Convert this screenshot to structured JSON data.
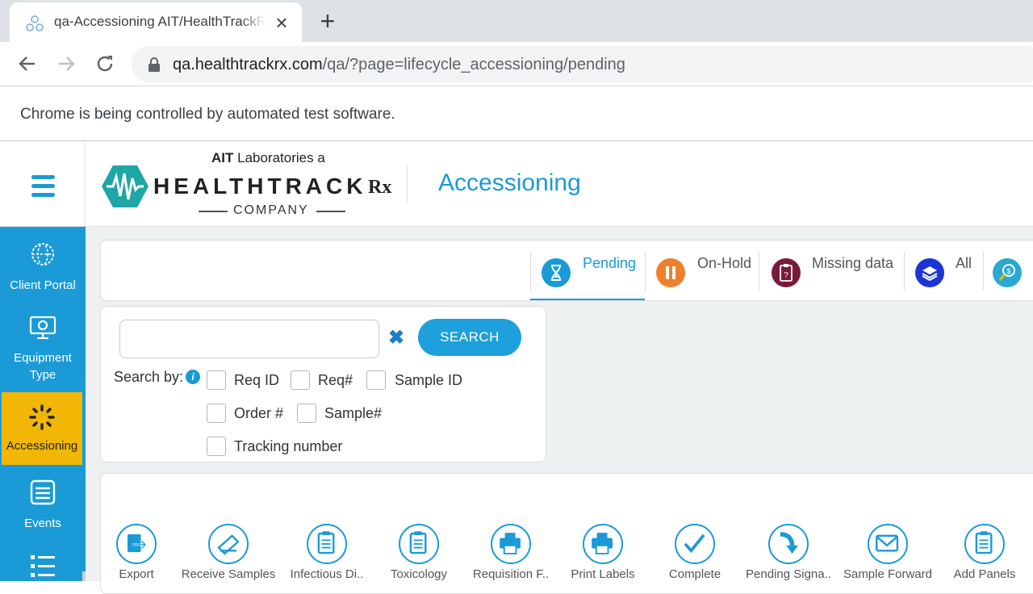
{
  "browser": {
    "tab_title": "qa-Accessioning AIT/HealthTrackRx",
    "url_host": "qa.healthtrackrx.com",
    "url_path": "/qa/?page=lifecycle_accessioning/pending",
    "infobar": "Chrome is being controlled by automated test software."
  },
  "logo": {
    "top_bold": "AIT",
    "top_light": "Laboratories a",
    "main": "HEALTHTRACK",
    "rx": "Rx",
    "company": "COMPANY"
  },
  "header": {
    "title": "Accessioning"
  },
  "sidebar": {
    "items": [
      {
        "label": "Client Portal"
      },
      {
        "label": "Equipment Type"
      },
      {
        "label": "Accessioning"
      },
      {
        "label": "Events"
      }
    ]
  },
  "status_tabs": [
    {
      "label": "Pending",
      "color": "#1a9ad6"
    },
    {
      "label": "On-Hold",
      "color": "#f07f2c"
    },
    {
      "label": "Missing data",
      "color": "#7a1a3a"
    },
    {
      "label": "All",
      "color": "#1a34d8"
    },
    {
      "label": "",
      "color": "#2aa8d4"
    }
  ],
  "search": {
    "value": "",
    "button": "SEARCH",
    "search_by": "Search by:",
    "info": "i",
    "options": [
      "Req ID",
      "Req#",
      "Sample ID",
      "Order #",
      "Sample#",
      "Tracking number"
    ]
  },
  "actions": [
    {
      "label": "Export"
    },
    {
      "label": "Receive Samples"
    },
    {
      "label": "Infectious Di.."
    },
    {
      "label": "Toxicology"
    },
    {
      "label": "Requisition F.."
    },
    {
      "label": "Print Labels"
    },
    {
      "label": "Complete"
    },
    {
      "label": "Pending Signa.."
    },
    {
      "label": "Sample Forward"
    },
    {
      "label": "Add Panels"
    }
  ],
  "colors": {
    "primary": "#1a9ad6",
    "active_nav": "#f2b705",
    "background": "#eef1f1"
  }
}
